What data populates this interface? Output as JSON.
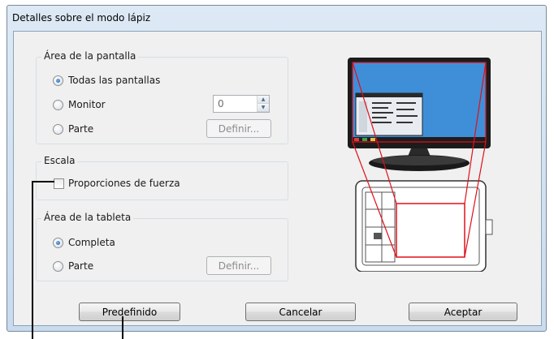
{
  "dialog": {
    "title": "Detalles sobre el modo lápiz"
  },
  "screen_area": {
    "title": "Área de la pantalla",
    "options": [
      {
        "label": "Todas las pantallas",
        "checked": true
      },
      {
        "label": "Monitor",
        "checked": false
      },
      {
        "label": "Parte",
        "checked": false
      }
    ],
    "monitor_value": "0",
    "define_label": "Definir..."
  },
  "scale": {
    "title": "Escala",
    "force_proportions_label": "Proporciones de fuerza",
    "force_proportions_checked": false
  },
  "tablet_area": {
    "title": "Área de la tableta",
    "options": [
      {
        "label": "Completa",
        "checked": true
      },
      {
        "label": "Parte",
        "checked": false
      }
    ],
    "define_label": "Definir..."
  },
  "buttons": {
    "default_label": "Predefinido",
    "cancel_label": "Cancelar",
    "accept_label": "Aceptar"
  },
  "colors": {
    "desktop_blue": "#3f8fd8",
    "mapping_red": "#e0101a",
    "bezel": "#1c1c1c"
  }
}
